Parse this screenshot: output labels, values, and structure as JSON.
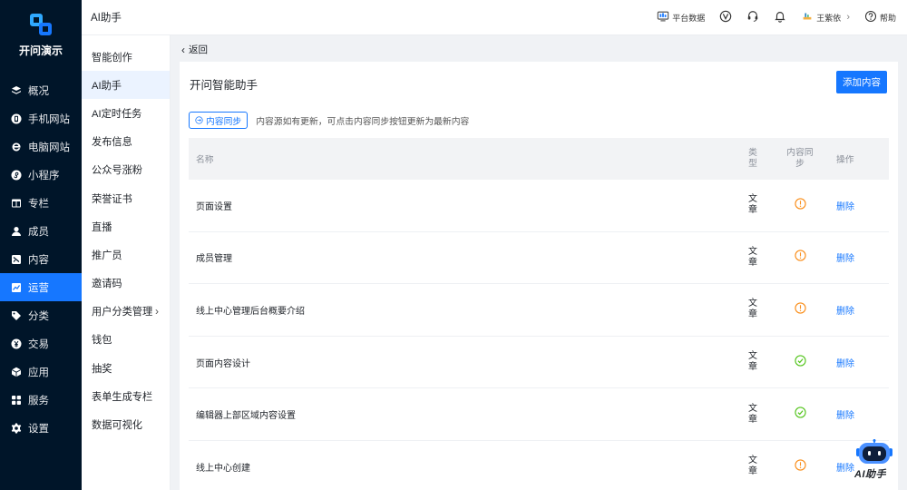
{
  "app": {
    "name": "开问演示"
  },
  "colors": {
    "sidebar_bg": "#001529",
    "accent": "#1677ff",
    "warning": "#fa8c16",
    "success": "#52c41a"
  },
  "sidebar": {
    "items": [
      {
        "label": "概况",
        "icon": "layers-icon"
      },
      {
        "label": "手机网站",
        "icon": "mobile-site-icon"
      },
      {
        "label": "电脑网站",
        "icon": "ie-icon"
      },
      {
        "label": "小程序",
        "icon": "miniprogram-icon"
      },
      {
        "label": "专栏",
        "icon": "column-icon"
      },
      {
        "label": "成员",
        "icon": "user-icon"
      },
      {
        "label": "内容",
        "icon": "content-icon"
      },
      {
        "label": "运营",
        "icon": "chart-icon"
      },
      {
        "label": "分类",
        "icon": "tag-icon"
      },
      {
        "label": "交易",
        "icon": "yen-icon"
      },
      {
        "label": "应用",
        "icon": "cube-icon"
      },
      {
        "label": "服务",
        "icon": "grid-icon"
      },
      {
        "label": "设置",
        "icon": "gear-icon"
      }
    ]
  },
  "header": {
    "title": "AI助手",
    "platform_data": "平台数据",
    "username": "王紫依",
    "help": "帮助"
  },
  "submenu": {
    "items": [
      {
        "label": "智能创作"
      },
      {
        "label": "AI助手"
      },
      {
        "label": "AI定时任务"
      },
      {
        "label": "发布信息"
      },
      {
        "label": "公众号涨粉"
      },
      {
        "label": "荣誉证书"
      },
      {
        "label": "直播"
      },
      {
        "label": "推广员"
      },
      {
        "label": "邀请码"
      },
      {
        "label": "用户分类管理",
        "has_arrow": true
      },
      {
        "label": "钱包"
      },
      {
        "label": "抽奖"
      },
      {
        "label": "表单生成专栏"
      },
      {
        "label": "数据可视化"
      }
    ]
  },
  "main": {
    "back_label": "返回",
    "card_title": "开问智能助手",
    "add_button": "添加内容",
    "sync_button": "内容同步",
    "sync_note": "内容源如有更新，可点击内容同步按钮更新为最新内容",
    "table": {
      "headers": {
        "name": "名称",
        "type": "类型",
        "sync": "内容同步",
        "op": "操作"
      },
      "rows": [
        {
          "name": "页面设置",
          "type": "文章",
          "sync_status": "warning",
          "op": "删除"
        },
        {
          "name": "成员管理",
          "type": "文章",
          "sync_status": "warning",
          "op": "删除"
        },
        {
          "name": "线上中心管理后台概要介绍",
          "type": "文章",
          "sync_status": "warning",
          "op": "删除"
        },
        {
          "name": "页面内容设计",
          "type": "文章",
          "sync_status": "success",
          "op": "删除"
        },
        {
          "name": "编辑器上部区域内容设置",
          "type": "文章",
          "sync_status": "success",
          "op": "删除"
        },
        {
          "name": "线上中心创建",
          "type": "文章",
          "sync_status": "warning",
          "op": "删除"
        }
      ]
    }
  },
  "ai_float": {
    "label": "AI助手"
  }
}
